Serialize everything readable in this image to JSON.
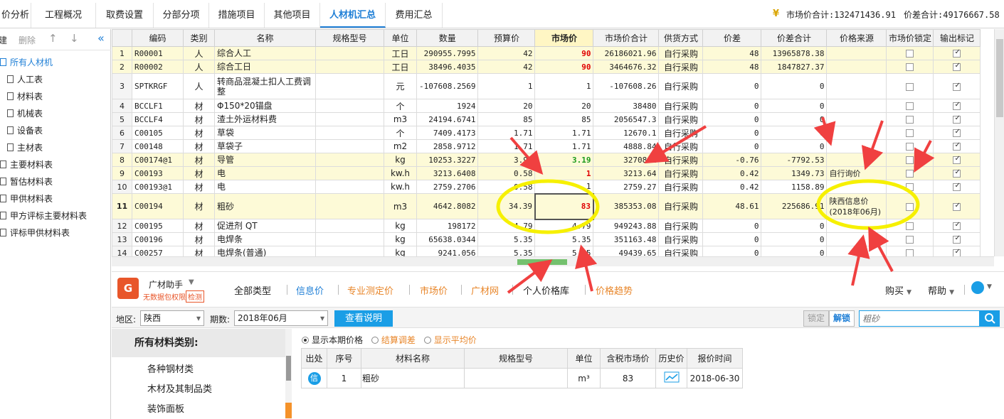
{
  "tabs": [
    "价分析",
    "工程概况",
    "取费设置",
    "分部分项",
    "措施项目",
    "其他项目",
    "人材机汇总",
    "费用汇总"
  ],
  "active_tab": "人材机汇总",
  "totals": {
    "market_total": "市场价合计:132471436.91",
    "diff_total": "价差合计:49176667.58"
  },
  "sidebar": {
    "tools": {
      "build": "建",
      "delete": "删除",
      "up": "↑",
      "down": "↓",
      "collapse": "«"
    },
    "items": [
      "所有人材机",
      "人工表",
      "材料表",
      "机械表",
      "设备表",
      "主材表",
      "主要材料表",
      "暂估材料表",
      "甲供材料表",
      "甲方评标主要材料表",
      "评标甲供材料表"
    ]
  },
  "grid": {
    "headers": [
      "",
      "编码",
      "类别",
      "名称",
      "规格型号",
      "单位",
      "数量",
      "预算价",
      "市场价",
      "市场价合计",
      "供货方式",
      "价差",
      "价差合计",
      "价格来源",
      "市场价锁定",
      "输出标记"
    ],
    "rows": [
      [
        "1",
        "R00001",
        "人",
        "综合人工",
        "",
        "工日",
        "290955.7995",
        "42",
        "90",
        "26186021.96",
        "自行采购",
        "48",
        "13965878.38",
        "",
        "",
        "✓"
      ],
      [
        "2",
        "R00002",
        "人",
        "综合工日",
        "",
        "工日",
        "38496.4035",
        "42",
        "90",
        "3464676.32",
        "自行采购",
        "48",
        "1847827.37",
        "",
        "",
        "✓"
      ],
      [
        "3",
        "SPTKRGF",
        "人",
        "转商品混凝土扣人工费调整",
        "",
        "元",
        "-107608.2569",
        "1",
        "1",
        "-107608.26",
        "自行采购",
        "0",
        "0",
        "",
        "",
        "✓"
      ],
      [
        "4",
        "BCCLF1",
        "材",
        "Φ150*20锚盘",
        "",
        "个",
        "1924",
        "20",
        "20",
        "38480",
        "自行采购",
        "0",
        "0",
        "",
        "",
        "✓"
      ],
      [
        "5",
        "BCCLF4",
        "材",
        "渣土外运材料费",
        "",
        "m3",
        "24194.6741",
        "85",
        "85",
        "2056547.3",
        "自行采购",
        "0",
        "0",
        "",
        "",
        "✓"
      ],
      [
        "6",
        "C00105",
        "材",
        "草袋",
        "",
        "个",
        "7409.4173",
        "1.71",
        "1.71",
        "12670.1",
        "自行采购",
        "0",
        "0",
        "",
        "",
        "✓"
      ],
      [
        "7",
        "C00148",
        "材",
        "草袋子",
        "",
        "m2",
        "2858.9712",
        "1.71",
        "1.71",
        "4888.84",
        "自行采购",
        "0",
        "0",
        "",
        "",
        "✓"
      ],
      [
        "8",
        "C00174@1",
        "材",
        "导管",
        "",
        "kg",
        "10253.3227",
        "3.95",
        "3.19",
        "32708.1",
        "自行采购",
        "-0.76",
        "-7792.53",
        "",
        "",
        "✓"
      ],
      [
        "9",
        "C00193",
        "材",
        "电",
        "",
        "kw.h",
        "3213.6408",
        "0.58",
        "1",
        "3213.64",
        "自行采购",
        "0.42",
        "1349.73",
        "自行询价",
        "",
        "✓"
      ],
      [
        "10",
        "C00193@1",
        "材",
        "电",
        "",
        "kw.h",
        "2759.2706",
        "0.58",
        "1",
        "2759.27",
        "自行采购",
        "0.42",
        "1158.89",
        "",
        "",
        "✓"
      ],
      [
        "11",
        "C00194",
        "材",
        "粗砂",
        "",
        "m3",
        "4642.8082",
        "34.39",
        "83",
        "385353.08",
        "自行采购",
        "48.61",
        "225686.91",
        "陕西信息价\n(2018年06月)",
        "",
        "✓"
      ],
      [
        "12",
        "C00195",
        "材",
        "促进剂 QT",
        "",
        "kg",
        "198172",
        "4.79",
        "4.79",
        "949243.88",
        "自行采购",
        "0",
        "0",
        "",
        "",
        "✓"
      ],
      [
        "13",
        "C00196",
        "材",
        "电焊条",
        "",
        "kg",
        "65638.0344",
        "5.35",
        "5.35",
        "351163.48",
        "自行采购",
        "0",
        "0",
        "",
        "",
        "✓"
      ],
      [
        "14",
        "C00257",
        "材",
        "电焊条(普通)",
        "",
        "kg",
        "9241.056",
        "5.35",
        "5.35",
        "49439.65",
        "自行采购",
        "0",
        "0",
        "",
        "",
        "✓"
      ]
    ]
  },
  "assistant": {
    "name": "广材助手",
    "sub1": "无数据包权限",
    "sub2": "检测",
    "tabs": [
      "全部类型",
      "信息价",
      "专业测定价",
      "市场价",
      "广材网",
      "个人价格库",
      "价格趋势"
    ],
    "active_tab": "信息价",
    "right_menu": [
      "购买",
      "帮助"
    ]
  },
  "filter": {
    "region_label": "地区:",
    "region_value": "陕西",
    "period_label": "期数:",
    "period_value": "2018年06月",
    "query_button": "查看说明",
    "lock_button": "锁定",
    "unlock_button": "解锁",
    "search_placeholder": "粗砂"
  },
  "categories": {
    "header": "所有材料类别:",
    "items": [
      "各种钢材类",
      "木材及其制品类",
      "装饰面板"
    ]
  },
  "info_panel": {
    "options": [
      "显示本期价格",
      "结算调差",
      "显示平均价"
    ],
    "headers": [
      "出处",
      "序号",
      "材料名称",
      "规格型号",
      "单位",
      "含税市场价",
      "历史价",
      "报价时间"
    ],
    "rows": [
      [
        "信",
        "1",
        "粗砂",
        "",
        "m³",
        "83",
        "",
        "2018-06-30"
      ]
    ]
  },
  "colors": {
    "accent": "#1f7fd6",
    "highlight_red": "#e00000",
    "annotation_yellow": "#f6f000",
    "annotation_arrow": "#f04040"
  }
}
